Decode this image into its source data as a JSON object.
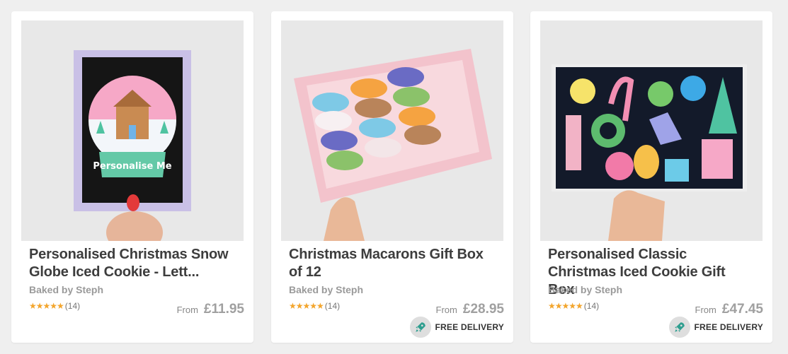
{
  "products": [
    {
      "title": "Personalised Christmas Snow Globe Iced Cookie - Lett...",
      "seller": "Baked by Steph",
      "stars": "★★★★★",
      "review_count": "(14)",
      "from_label": "From",
      "price": "£11.95",
      "delivery": null
    },
    {
      "title": "Christmas Macarons Gift Box of 12",
      "seller": "Baked by Steph",
      "stars": "★★★★★",
      "review_count": "(14)",
      "from_label": "From",
      "price": "£28.95",
      "delivery": {
        "label": "FREE DELIVERY",
        "icon": "rocket-icon"
      }
    },
    {
      "title": "Personalised Classic Christmas Iced Cookie Gift Box",
      "seller": "Baked by Steph",
      "stars": "★★★★★",
      "review_count": "(14)",
      "from_label": "From",
      "price": "£47.45",
      "delivery": {
        "label": "FREE DELIVERY",
        "icon": "rocket-icon"
      }
    }
  ],
  "rating_value": 5,
  "colors": {
    "background": "#efefef",
    "card": "#ffffff",
    "title": "#3d3d3d",
    "seller": "#9a9a9a",
    "star": "#f3a52c",
    "price": "#a0a0a0",
    "rocket": "#2f9e8f"
  },
  "images": [
    "snow-globe-cookie-photo",
    "macarons-gift-box-photo",
    "christmas-cookie-gift-box-photo"
  ],
  "image_text": {
    "snow_globe_cookie": "Personalise Me"
  }
}
